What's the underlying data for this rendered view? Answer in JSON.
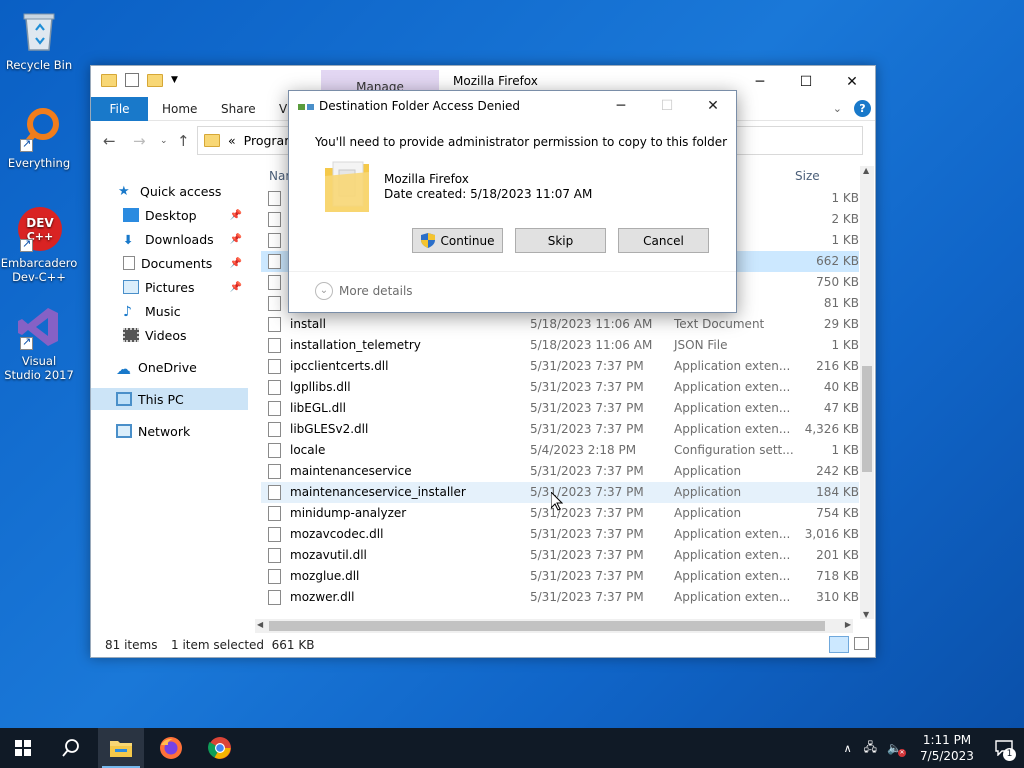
{
  "desktop": {
    "icons": [
      {
        "label": "Recycle Bin"
      },
      {
        "label": "Everything"
      },
      {
        "label": "Embarcadero Dev-C++"
      },
      {
        "label": "Visual Studio 2017"
      }
    ],
    "devcpp_logo_text": "DEV C++"
  },
  "explorer": {
    "title": "Mozilla Firefox",
    "manage_tab": "Manage",
    "ribbon": {
      "file": "File",
      "home": "Home",
      "share": "Share",
      "view": "Vi"
    },
    "address": {
      "prefix": "«",
      "path": "Program ..."
    },
    "nav": [
      {
        "label": "Quick access"
      },
      {
        "label": "Desktop"
      },
      {
        "label": "Downloads"
      },
      {
        "label": "Documents"
      },
      {
        "label": "Pictures"
      },
      {
        "label": "Music"
      },
      {
        "label": "Videos"
      },
      {
        "label": "OneDrive"
      },
      {
        "label": "This PC"
      },
      {
        "label": "Network"
      }
    ],
    "columns": {
      "name": "Nar",
      "size": "Size"
    },
    "partial_rows": [
      {
        "type": "",
        "size": "1 KB"
      },
      {
        "type": "",
        "size": "2 KB"
      },
      {
        "type": "ument",
        "size": "1 KB"
      },
      {
        "type": "",
        "size": "662 KB"
      },
      {
        "type": "exten...",
        "size": "750 KB"
      },
      {
        "type": "exten...",
        "size": "81 KB"
      }
    ],
    "rows": [
      {
        "name": "install",
        "date": "5/18/2023 11:06 AM",
        "type": "Text Document",
        "size": "29 KB"
      },
      {
        "name": "installation_telemetry",
        "date": "5/18/2023 11:06 AM",
        "type": "JSON File",
        "size": "1 KB"
      },
      {
        "name": "ipcclientcerts.dll",
        "date": "5/31/2023 7:37 PM",
        "type": "Application exten...",
        "size": "216 KB"
      },
      {
        "name": "lgpllibs.dll",
        "date": "5/31/2023 7:37 PM",
        "type": "Application exten...",
        "size": "40 KB"
      },
      {
        "name": "libEGL.dll",
        "date": "5/31/2023 7:37 PM",
        "type": "Application exten...",
        "size": "47 KB"
      },
      {
        "name": "libGLESv2.dll",
        "date": "5/31/2023 7:37 PM",
        "type": "Application exten...",
        "size": "4,326 KB"
      },
      {
        "name": "locale",
        "date": "5/4/2023 2:18 PM",
        "type": "Configuration sett...",
        "size": "1 KB"
      },
      {
        "name": "maintenanceservice",
        "date": "5/31/2023 7:37 PM",
        "type": "Application",
        "size": "242 KB"
      },
      {
        "name": "maintenanceservice_installer",
        "date": "5/31/2023 7:37 PM",
        "type": "Application",
        "size": "184 KB"
      },
      {
        "name": "minidump-analyzer",
        "date": "5/31/2023 7:37 PM",
        "type": "Application",
        "size": "754 KB"
      },
      {
        "name": "mozavcodec.dll",
        "date": "5/31/2023 7:37 PM",
        "type": "Application exten...",
        "size": "3,016 KB"
      },
      {
        "name": "mozavutil.dll",
        "date": "5/31/2023 7:37 PM",
        "type": "Application exten...",
        "size": "201 KB"
      },
      {
        "name": "mozglue.dll",
        "date": "5/31/2023 7:37 PM",
        "type": "Application exten...",
        "size": "718 KB"
      },
      {
        "name": "mozwer.dll",
        "date": "5/31/2023 7:37 PM",
        "type": "Application exten...",
        "size": "310 KB"
      }
    ],
    "status": {
      "count": "81 items",
      "selected": "1 item selected  661 KB"
    }
  },
  "dialog": {
    "title": "Destination Folder Access Denied",
    "message": "You'll need to provide administrator permission to copy to this folder",
    "folder_name": "Mozilla Firefox",
    "folder_date": "Date created: 5/18/2023 11:07 AM",
    "continue": "Continue",
    "skip": "Skip",
    "cancel": "Cancel",
    "more_details": "More details"
  },
  "taskbar": {
    "time": "1:11 PM",
    "date": "7/5/2023",
    "notification_count": "1"
  },
  "colors": {
    "accent": "#1979ca",
    "taskbar": "#101a26",
    "selection": "#cce8ff"
  }
}
